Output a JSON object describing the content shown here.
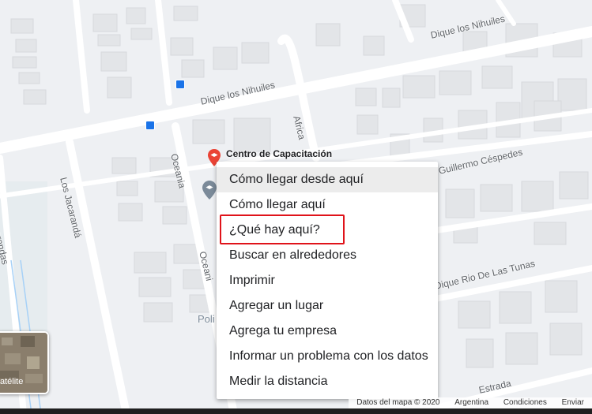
{
  "map": {
    "streets": [
      "Dique los Nihuiles",
      "Dique los Nihuiles",
      "Africa",
      "Oceania",
      "Los Jacarandá",
      "Jacarandas",
      "Guillermo Céspedes",
      "Dique Rio De Las Tunas",
      "Estrada",
      "Oceani"
    ],
    "poi_label": "Centro de Capacitación",
    "poi2_label": "Poli",
    "bus_icon": "bus-stop-icon",
    "pin_icon": "school-pin-icon",
    "pin2_icon": "place-pin-icon"
  },
  "context_menu": {
    "items": [
      "Cómo llegar desde aquí",
      "Cómo llegar aquí",
      "¿Qué hay aquí?",
      "Buscar en alrededores",
      "Imprimir",
      "Agregar un lugar",
      "Agrega tu empresa",
      "Informar un problema con los datos",
      "Medir la distancia"
    ]
  },
  "satellite": {
    "label": "atélite"
  },
  "footer": {
    "map_data": "Datos del mapa © 2020",
    "country": "Argentina",
    "terms": "Condiciones",
    "send": "Enviar"
  },
  "colors": {
    "highlight_box": "#e0131a",
    "bus": "#1a73e8",
    "pin": "#ea4335"
  }
}
